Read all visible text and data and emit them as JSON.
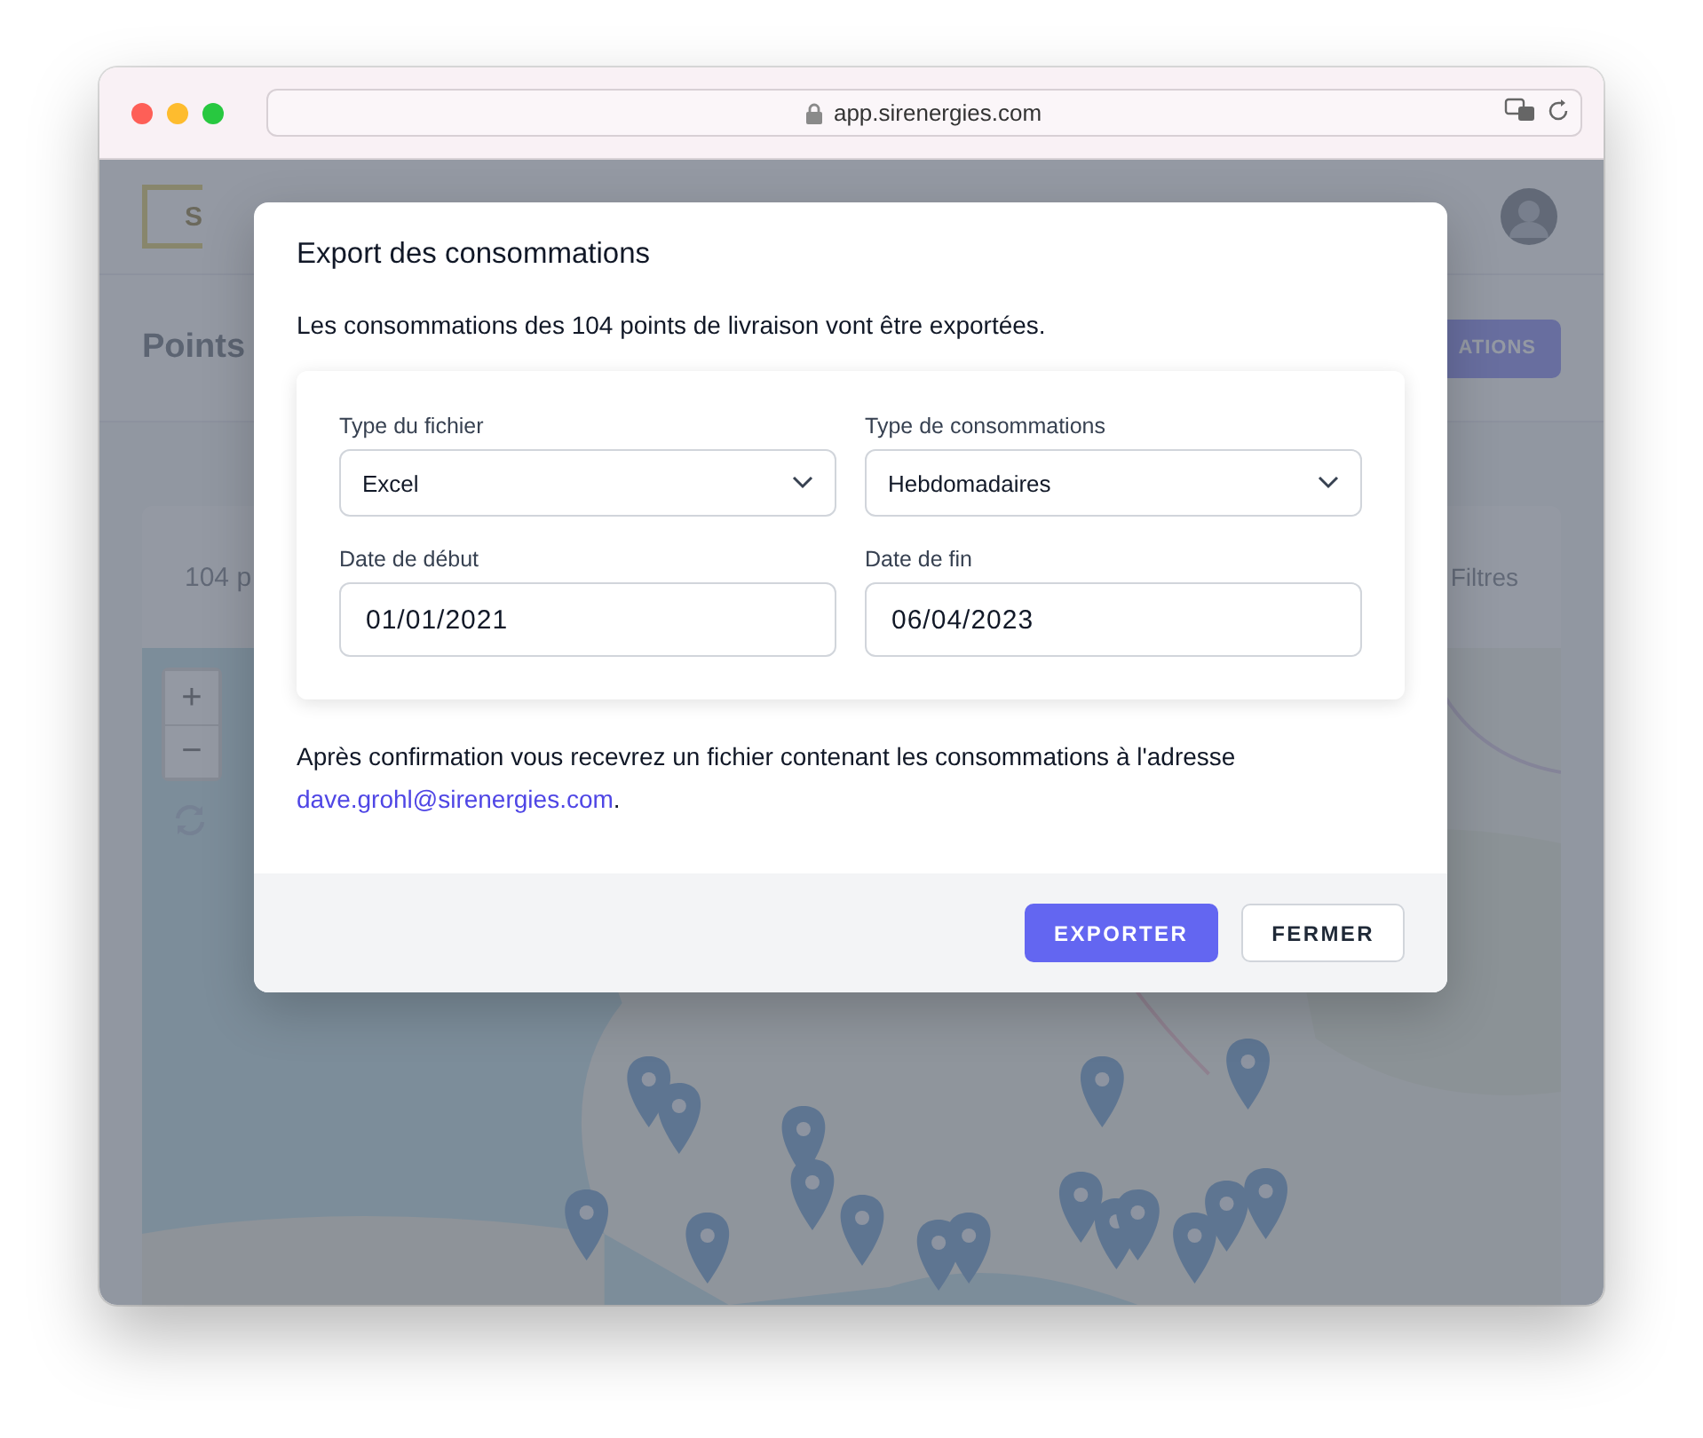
{
  "browser": {
    "url": "app.sirenergies.com"
  },
  "page": {
    "logo_letter": "S",
    "heading": "Points",
    "action_button": "ATIONS",
    "list_count": "104 p",
    "filters": "Filtres",
    "map": {
      "kind": "picture",
      "zoom_in": "+",
      "zoom_out": "−"
    }
  },
  "dialog": {
    "title": "Export des consommations",
    "message": "Les consommations des 104 points de livraison vont être exportées.",
    "fields": [
      {
        "kind": "select",
        "label": "Type du fichier",
        "value": "Excel"
      },
      {
        "kind": "select",
        "label": "Type de consommations",
        "value": "Hebdomadaires"
      },
      {
        "kind": "date",
        "label": "Date de début",
        "value": "01/01/2021"
      },
      {
        "kind": "date",
        "label": "Date de fin",
        "value": "06/04/2023"
      }
    ],
    "note": "Après confirmation vous recevrez un fichier contenant les consommations à l'adresse",
    "email": "dave.grohl@sirenergies.com",
    "note_end": ".",
    "buttons": [
      {
        "label": "EXPORTER",
        "primary": true
      },
      {
        "label": "FERMER",
        "primary": false
      }
    ]
  }
}
